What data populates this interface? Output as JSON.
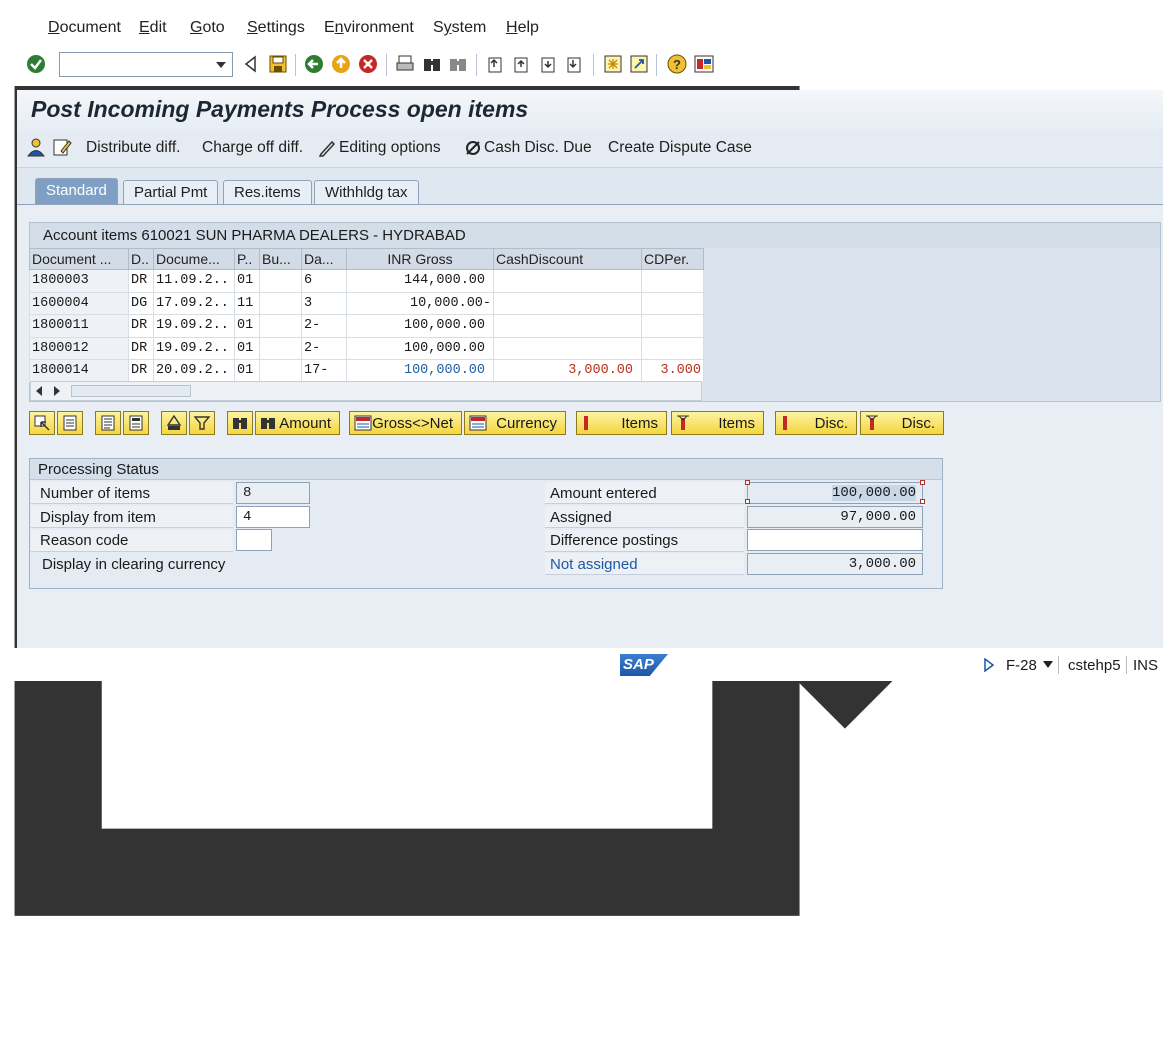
{
  "menu": {
    "items": [
      "Document",
      "Edit",
      "Goto",
      "Settings",
      "Environment",
      "System",
      "Help"
    ],
    "underline": [
      "D",
      "E",
      "G",
      "S",
      "n",
      "y",
      "H"
    ]
  },
  "toolbar": {
    "command_value": ""
  },
  "page": {
    "title": "Post Incoming Payments Process open items"
  },
  "app_toolbar": {
    "distribute_diff": "Distribute diff.",
    "charge_off_diff": "Charge off diff.",
    "editing_options": "Editing options",
    "cash_disc_due": "Cash Disc. Due",
    "create_dispute_case": "Create Dispute Case"
  },
  "tabs": [
    {
      "label": "Standard",
      "active": true
    },
    {
      "label": "Partial Pmt",
      "active": false
    },
    {
      "label": "Res.items",
      "active": false
    },
    {
      "label": "Withhldg tax",
      "active": false
    }
  ],
  "table": {
    "title": "Account items 610021 SUN PHARMA DEALERS - HYDRABAD",
    "columns": [
      "Document ...",
      "D..",
      "Docume...",
      "P..",
      "Bu...",
      "Da...",
      "INR Gross",
      "CashDiscount",
      "CDPer."
    ],
    "rows": [
      {
        "doc": "1800003",
        "d": "DR",
        "date": "11.09.2..",
        "p": "01",
        "bu": "",
        "da": "6",
        "gross": "144,000.00",
        "cash": "",
        "cdper": ""
      },
      {
        "doc": "1600004",
        "d": "DG",
        "date": "17.09.2..",
        "p": "11",
        "bu": "",
        "da": "3",
        "gross": "10,000.00-",
        "cash": "",
        "cdper": ""
      },
      {
        "doc": "1800011",
        "d": "DR",
        "date": "19.09.2..",
        "p": "01",
        "bu": "",
        "da": "2-",
        "gross": "100,000.00",
        "cash": "",
        "cdper": ""
      },
      {
        "doc": "1800012",
        "d": "DR",
        "date": "19.09.2..",
        "p": "01",
        "bu": "",
        "da": "2-",
        "gross": "100,000.00",
        "cash": "",
        "cdper": ""
      },
      {
        "doc": "1800014",
        "d": "DR",
        "date": "20.09.2..",
        "p": "01",
        "bu": "",
        "da": "17-",
        "gross": "100,000.00",
        "cash": "3,000.00",
        "cdper": "3.000"
      }
    ]
  },
  "buttons": {
    "amount": "Amount",
    "gross_net": "Gross<>Net",
    "currency": "Currency",
    "items_activate": "Items",
    "items_deactivate": "Items",
    "disc_activate": "Disc.",
    "disc_deactivate": "Disc."
  },
  "processing_status": {
    "title": "Processing Status",
    "number_of_items_label": "Number of items",
    "number_of_items": "8",
    "display_from_item_label": "Display from item",
    "display_from_item": "4",
    "reason_code_label": "Reason code",
    "reason_code": "",
    "display_clearing_label": "Display in clearing currency",
    "amount_entered_label": "Amount entered",
    "amount_entered": "100,000.00",
    "assigned_label": "Assigned",
    "assigned": "97,000.00",
    "difference_postings_label": "Difference postings",
    "difference_postings": "",
    "not_assigned_label": "Not assigned",
    "not_assigned": "3,000.00"
  },
  "statusbar": {
    "logo": "SAP",
    "transaction": "F-28",
    "system": "cstehp5",
    "mode": "INS"
  }
}
